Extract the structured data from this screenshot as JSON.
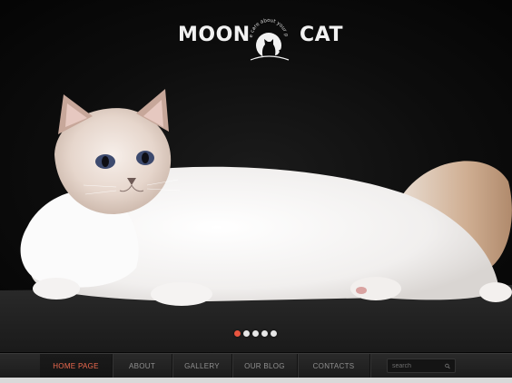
{
  "logo": {
    "left_word": "MOON",
    "right_word": "CAT",
    "tagline": "we care about your pet",
    "emblem_icon": "moon-cat-silhouette-icon"
  },
  "hero": {
    "image": "white-fluffy-cat-lying-on-dark-background",
    "slides_total": 5,
    "active_slide": 1
  },
  "nav": {
    "items": [
      {
        "label": "HOME PAGE",
        "active": true
      },
      {
        "label": "ABOUT",
        "active": false
      },
      {
        "label": "GALLERY",
        "active": false
      },
      {
        "label": "OUR BLOG",
        "active": false
      },
      {
        "label": "CONTACTS",
        "active": false
      }
    ],
    "search_placeholder": "search",
    "search_icon": "search-icon"
  },
  "colors": {
    "accent": "#ef6a4f",
    "background": "#0b0b0b",
    "nav_text": "#8f8f8f"
  }
}
